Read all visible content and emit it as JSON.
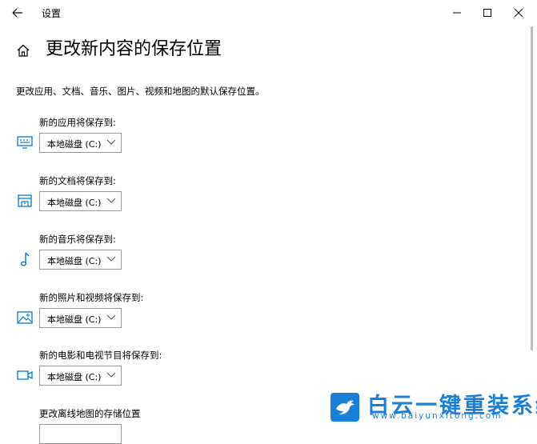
{
  "window": {
    "title": "设置"
  },
  "header": {
    "title": "更改新内容的保存位置"
  },
  "description": "更改应用、文档、音乐、图片、视频和地图的默认保存位置。",
  "groups": [
    {
      "label": "新的应用将保存到:",
      "icon": "monitor-icon",
      "value": "本地磁盘 (C:)"
    },
    {
      "label": "新的文档将保存到:",
      "icon": "drive-icon",
      "value": "本地磁盘 (C:)"
    },
    {
      "label": "新的音乐将保存到:",
      "icon": "music-note-icon",
      "value": "本地磁盘 (C:)"
    },
    {
      "label": "新的照片和视频将保存到:",
      "icon": "picture-icon",
      "value": "本地磁盘 (C:)"
    },
    {
      "label": "新的电影和电视节目将保存到:",
      "icon": "video-camera-icon",
      "value": "本地磁盘 (C:)"
    },
    {
      "label": "更改离线地图的存储位置",
      "icon": "",
      "value": ""
    }
  ],
  "watermark": {
    "name": "白云一键重装系统",
    "url": "www.baiyunxitong.com"
  },
  "colors": {
    "accent": "#0078d7",
    "watermark": "#1a7fd6"
  }
}
